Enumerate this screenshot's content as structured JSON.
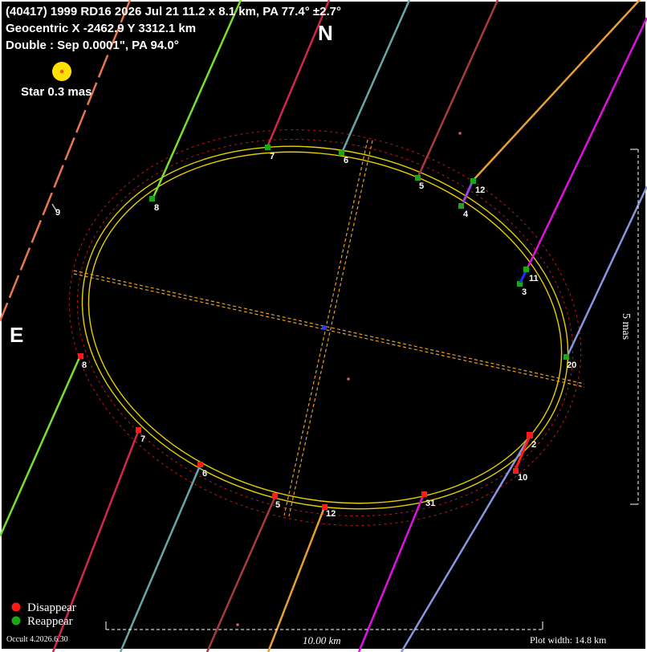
{
  "header": {
    "line1": "(40417) 1999 RD16  2026 Jul 21   11.2 x 8.1 km, PA 77.4° ±2.7°",
    "line2": "Geocentric  X  -2462.9  Y 3312.1 km",
    "line3": "Double : Sep  0.0001\", PA 94.0°"
  },
  "star_label": "Star 0.3 mas",
  "compass": {
    "north": "N",
    "east": "E"
  },
  "legend": {
    "disappear": "Disappear",
    "reappear": "Reappear"
  },
  "version": "Occult 4.2026.6.30",
  "scale_bar": {
    "label": "10.00 km"
  },
  "plot_width": "Plot width: 14.8 km",
  "vertical_scale": "5 mas",
  "colors": {
    "background": "#000000",
    "ellipse": "#e8d000",
    "axes": "#e8a020",
    "limit_circle": "#c01818",
    "disappear": "#ff1a1a",
    "reappear": "#1aa81a",
    "star": "#ffe000"
  },
  "chords": [
    {
      "id": "2",
      "color": "#8a96e0"
    },
    {
      "id": "3",
      "color": "#8a96e0"
    },
    {
      "id": "4",
      "color": "#e8a030"
    },
    {
      "id": "5",
      "color": "#a83c3c"
    },
    {
      "id": "6",
      "color": "#66a8a8"
    },
    {
      "id": "7",
      "color": "#d02848"
    },
    {
      "id": "8",
      "color": "#78e030"
    },
    {
      "id": "9",
      "color": "#e8784c"
    },
    {
      "id": "10",
      "color": "#8a96e0"
    },
    {
      "id": "11",
      "color": "#e010e0"
    },
    {
      "id": "12",
      "color": "#e8a030"
    }
  ]
}
